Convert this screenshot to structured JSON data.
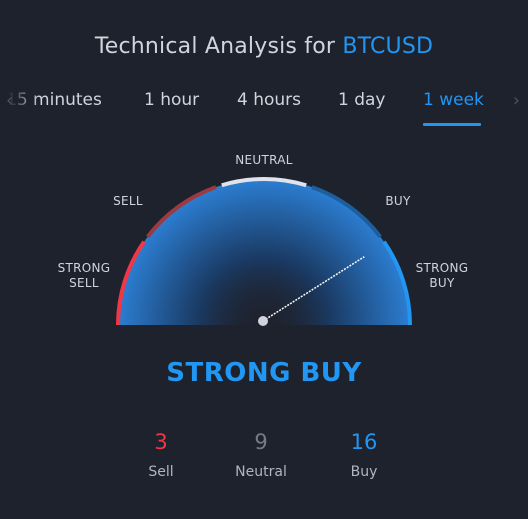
{
  "header": {
    "title_prefix": "Technical Analysis for ",
    "symbol": "BTCUSD"
  },
  "tabs": [
    {
      "label": "15 minutes",
      "active": false
    },
    {
      "label": "1 hour",
      "active": false
    },
    {
      "label": "4 hours",
      "active": false
    },
    {
      "label": "1 day",
      "active": false
    },
    {
      "label": "1 week",
      "active": true
    }
  ],
  "nav": {
    "left_icon": "chevron-left-icon",
    "right_icon": "chevron-right-icon"
  },
  "gauge": {
    "labels": {
      "strong_sell": "STRONG\nSELL",
      "sell": "SELL",
      "neutral": "NEUTRAL",
      "buy": "BUY",
      "strong_buy": "STRONG\nBUY"
    },
    "needle_value": 0.82
  },
  "summary": {
    "result": "STRONG BUY"
  },
  "counts": {
    "sell": {
      "value": "3",
      "label": "Sell"
    },
    "neutral": {
      "value": "9",
      "label": "Neutral"
    },
    "buy": {
      "value": "16",
      "label": "Buy"
    }
  },
  "colors": {
    "accent": "#2196f3",
    "sell": "#f23645",
    "sell_dark": "#9c3a41",
    "neutral": "#787b86",
    "neutral_arc": "#e0e3eb",
    "buy_dark": "#1c5f9c",
    "background": "#1e222d"
  }
}
